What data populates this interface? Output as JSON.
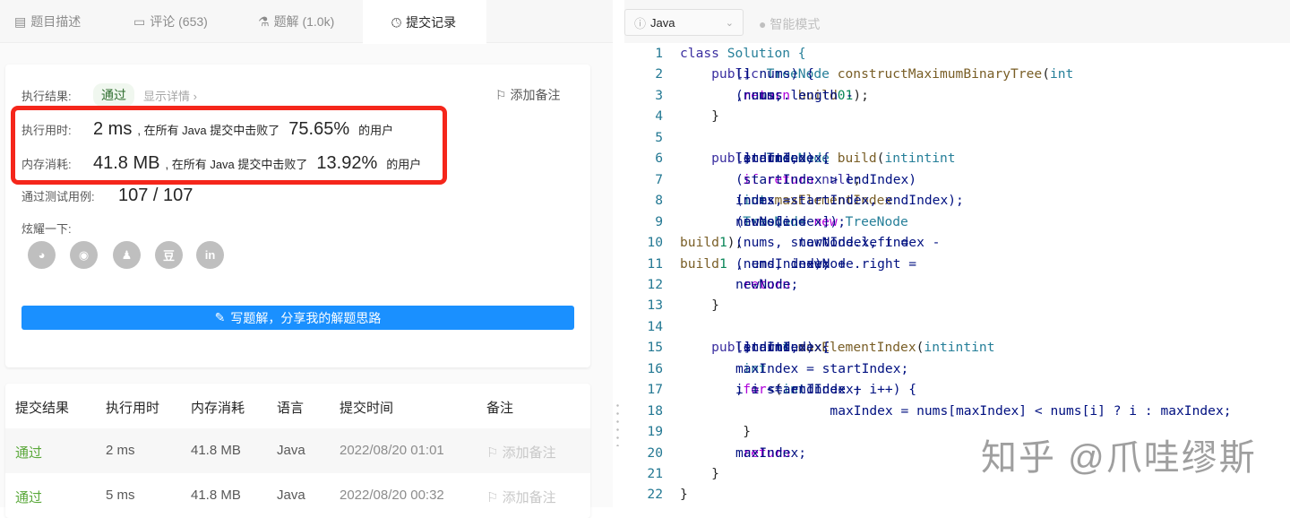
{
  "tabs": [
    {
      "label": "题目描述",
      "icon": "description-icon"
    },
    {
      "label": "评论 (653)",
      "icon": "comment-icon"
    },
    {
      "label": "题解 (1.0k)",
      "icon": "flask-icon"
    },
    {
      "label": "提交记录",
      "icon": "clock-icon",
      "active": true
    }
  ],
  "result": {
    "label": "执行结果:",
    "status": "通过",
    "details": "显示详情 ›",
    "add_note": "添加备注",
    "runtime_label": "执行用时:",
    "runtime": "2 ms",
    "beat_text": ", 在所有 Java 提交中击败了",
    "runtime_pct": "75.65%",
    "users": "的用户",
    "memory_label": "内存消耗:",
    "memory": "41.8 MB",
    "memory_pct": "13.92%",
    "cases_label": "通过测试用例:",
    "cases": "107 / 107",
    "share_label": "炫耀一下:",
    "share": [
      "wechat",
      "weibo",
      "qq",
      "douban",
      "in"
    ],
    "write_button": "写题解，分享我的解题思路"
  },
  "table": {
    "headers": [
      "提交结果",
      "执行用时",
      "内存消耗",
      "语言",
      "提交时间",
      "备注"
    ],
    "rows": [
      [
        "通过",
        "2 ms",
        "41.8 MB",
        "Java",
        "2022/08/20 01:01",
        "添加备注"
      ],
      [
        "通过",
        "5 ms",
        "41.8 MB",
        "Java",
        "2022/08/20 00:32",
        "添加备注"
      ]
    ]
  },
  "editor": {
    "language": "Java",
    "smart_mode": "智能模式",
    "lines": [
      [
        [
          "class",
          "kw"
        ],
        [
          " Solution {",
          "ty"
        ]
      ],
      [
        [
          "    public ",
          "kw"
        ],
        [
          "TreeNode ",
          "ty"
        ],
        [
          "constructMaximumBinaryTree",
          "fn"
        ],
        [
          "(",
          "pl"
        ],
        [
          "int",
          "ty"
        ],
        [
          "[] nums) {",
          "cl"
        ]
      ],
      [
        [
          "        return ",
          "ctl"
        ],
        [
          "build",
          "fn"
        ],
        [
          "(nums, ",
          "cl"
        ],
        [
          "0",
          "num"
        ],
        [
          ", nums.length - ",
          "cl"
        ],
        [
          "1",
          "num"
        ],
        [
          ");",
          "pl"
        ]
      ],
      [
        [
          "    }",
          "pl"
        ]
      ],
      [
        [
          "",
          ""
        ]
      ],
      [
        [
          "    public ",
          "kw"
        ],
        [
          "TreeNode ",
          "ty"
        ],
        [
          "build",
          "fn"
        ],
        [
          "(",
          "pl"
        ],
        [
          "int",
          "ty"
        ],
        [
          "[] nums, ",
          "cl"
        ],
        [
          "int",
          "ty"
        ],
        [
          " startIndex, ",
          "cl"
        ],
        [
          "int",
          "ty"
        ],
        [
          " endIndex) {",
          "cl"
        ]
      ],
      [
        [
          "        if ",
          "ctl"
        ],
        [
          "(startIndex > endIndex) ",
          "cl"
        ],
        [
          "return ",
          "ctl"
        ],
        [
          "null",
          "kw"
        ],
        [
          ";",
          "pl"
        ]
      ],
      [
        [
          "        int ",
          "ty"
        ],
        [
          "index = ",
          "cl"
        ],
        [
          "maxElementIndex",
          "fn"
        ],
        [
          "(nums, startIndex, endIndex);",
          "cl"
        ]
      ],
      [
        [
          "        TreeNode ",
          "ty"
        ],
        [
          "newNode = ",
          "cl"
        ],
        [
          "new ",
          "ctl"
        ],
        [
          "TreeNode",
          "ty"
        ],
        [
          "(nums[index]);",
          "cl"
        ]
      ],
      [
        [
          "        newNode.left = ",
          "cl"
        ],
        [
          "build",
          "fn"
        ],
        [
          "(nums, startIndex, index - ",
          "cl"
        ],
        [
          "1",
          "num"
        ],
        [
          ");",
          "pl"
        ]
      ],
      [
        [
          "        newNode.right = ",
          "cl"
        ],
        [
          "build",
          "fn"
        ],
        [
          "(nums, index + ",
          "cl"
        ],
        [
          "1",
          "num"
        ],
        [
          ", endIndex);",
          "cl"
        ]
      ],
      [
        [
          "        return ",
          "ctl"
        ],
        [
          "newNode;",
          "cl"
        ]
      ],
      [
        [
          "    }",
          "pl"
        ]
      ],
      [
        [
          "",
          ""
        ]
      ],
      [
        [
          "    public ",
          "kw"
        ],
        [
          "int ",
          "ty"
        ],
        [
          "maxElementIndex",
          "fn"
        ],
        [
          "(",
          "pl"
        ],
        [
          "int",
          "ty"
        ],
        [
          "[] nums, ",
          "cl"
        ],
        [
          "int",
          "ty"
        ],
        [
          " startIndex, ",
          "cl"
        ],
        [
          "int",
          "ty"
        ],
        [
          " endIndex) {",
          "cl"
        ]
      ],
      [
        [
          "        int ",
          "ty"
        ],
        [
          "maxIndex = startIndex;",
          "cl"
        ]
      ],
      [
        [
          "        for ",
          "ctl"
        ],
        [
          "(",
          "pl"
        ],
        [
          "int ",
          "ty"
        ],
        [
          "i = startIndex + ",
          "cl"
        ],
        [
          "1",
          "num"
        ],
        [
          "; i <= endIndex; i++) {",
          "cl"
        ]
      ],
      [
        [
          "            maxIndex = nums[maxIndex] < nums[i] ? i : maxIndex;",
          "cl"
        ]
      ],
      [
        [
          "        }",
          "pl"
        ]
      ],
      [
        [
          "        return ",
          "ctl"
        ],
        [
          "maxIndex;",
          "cl"
        ]
      ],
      [
        [
          "    }",
          "pl"
        ]
      ],
      [
        [
          "}",
          "pl"
        ]
      ]
    ]
  },
  "watermark": "知乎 @爪哇缪斯"
}
